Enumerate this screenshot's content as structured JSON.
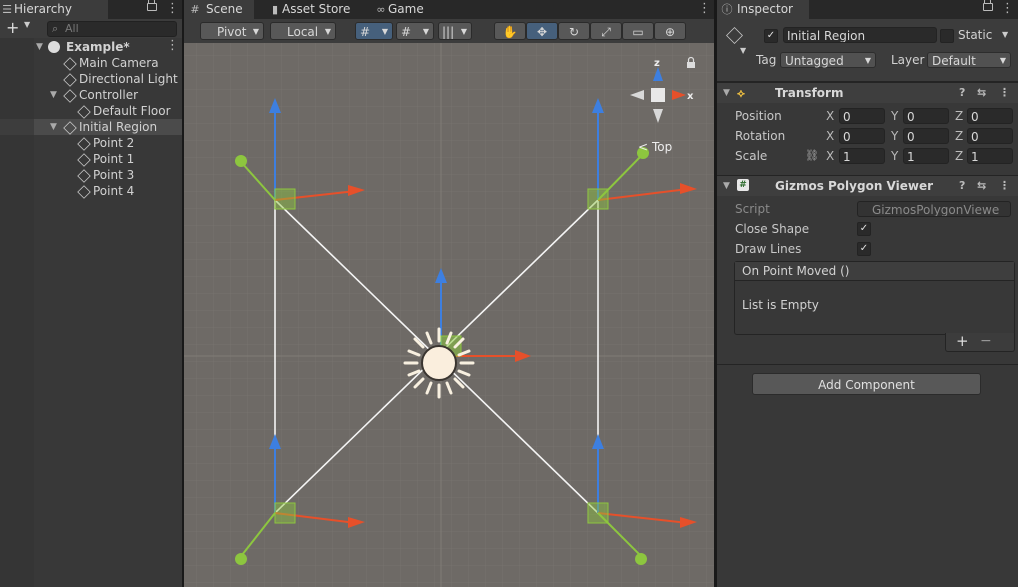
{
  "hierarchy": {
    "title": "Hierarchy",
    "search_placeholder": "All",
    "add_label": "+",
    "rows": [
      {
        "label": "Example*"
      },
      {
        "label": "Main Camera"
      },
      {
        "label": "Directional Light"
      },
      {
        "label": "Controller"
      },
      {
        "label": "Default Floor"
      },
      {
        "label": "Initial Region"
      },
      {
        "label": "Point 2"
      },
      {
        "label": "Point 1"
      },
      {
        "label": "Point 3"
      },
      {
        "label": "Point 4"
      }
    ]
  },
  "scene": {
    "tabs": [
      {
        "label": "Scene"
      },
      {
        "label": "Asset Store"
      },
      {
        "label": "Game"
      }
    ],
    "toolbar": {
      "pivot": "Pivot",
      "local": "Local"
    },
    "orientation": "Top",
    "gizmo_labels": {
      "x": "x",
      "z": "z"
    }
  },
  "inspector": {
    "title": "Inspector",
    "object": {
      "name": "Initial Region",
      "static_label": "Static",
      "tag_label": "Tag",
      "tag": "Untagged",
      "layer_label": "Layer",
      "layer": "Default"
    },
    "transform": {
      "title": "Transform",
      "position_label": "Position",
      "rotation_label": "Rotation",
      "scale_label": "Scale",
      "axes": {
        "x": "X",
        "y": "Y",
        "z": "Z"
      },
      "position": {
        "x": "0",
        "y": "0",
        "z": "0"
      },
      "rotation": {
        "x": "0",
        "y": "0",
        "z": "0"
      },
      "scale": {
        "x": "1",
        "y": "1",
        "z": "1"
      }
    },
    "gizmos": {
      "title": "Gizmos Polygon Viewer",
      "script_label": "Script",
      "script_value": "GizmosPolygonViewe",
      "close_shape_label": "Close Shape",
      "draw_lines_label": "Draw Lines",
      "event_title": "On Point Moved ()",
      "event_empty": "List is Empty",
      "plus": "+",
      "minus": "−"
    },
    "add_component": "Add Component"
  },
  "colors": {
    "accent_blue": "#46607c",
    "scene_bg": "#6e6a66",
    "x_axis": "#e6502a",
    "y_axis": "#8dc63f",
    "z_axis": "#3d7fe0"
  }
}
